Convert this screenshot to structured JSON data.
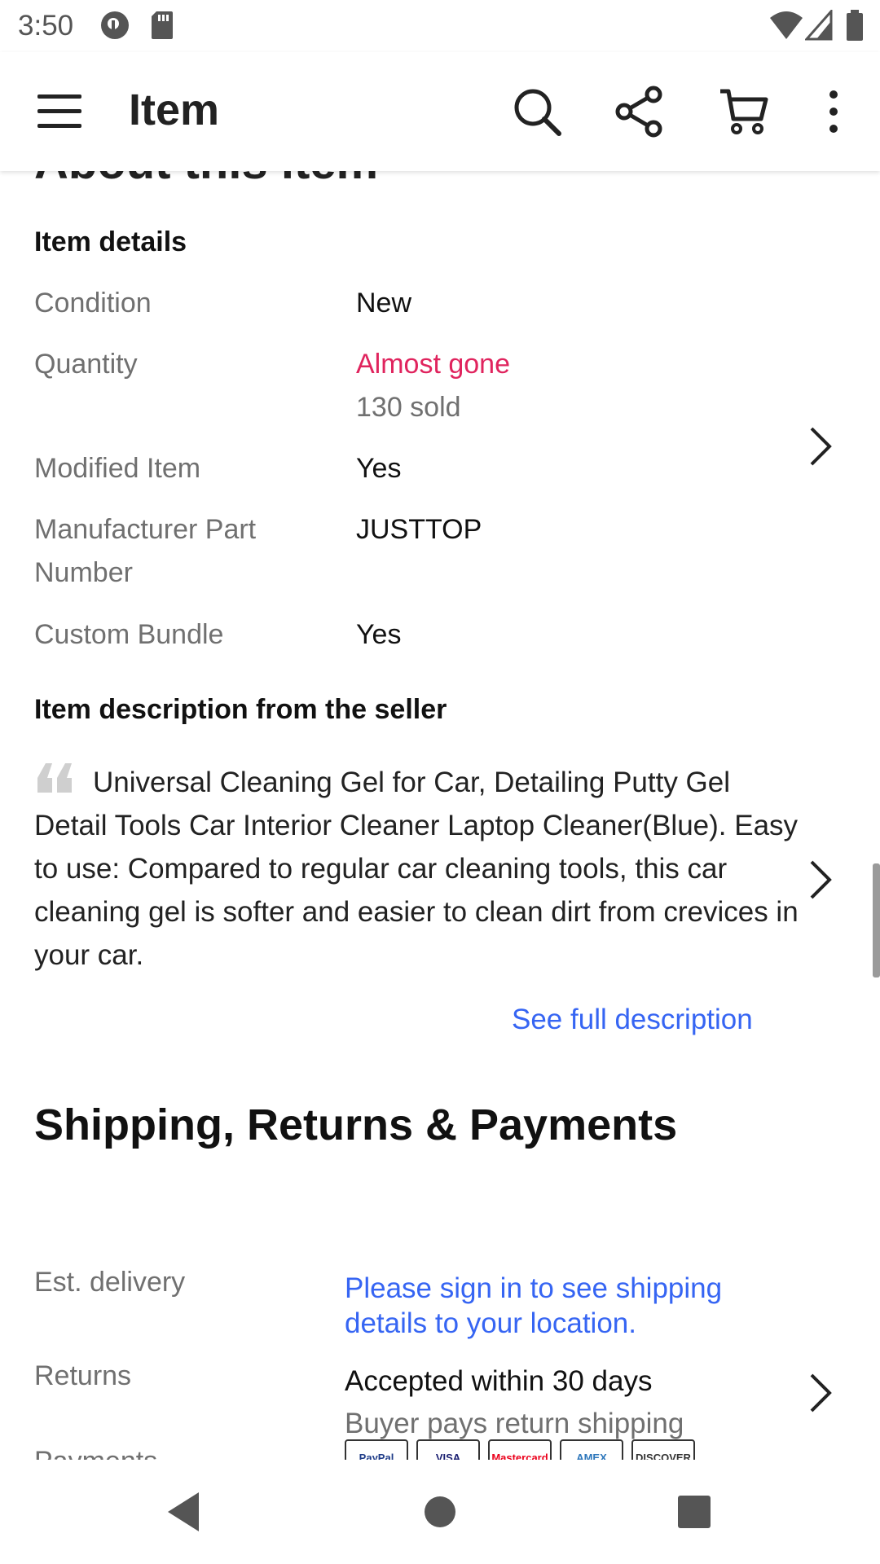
{
  "status_bar": {
    "time": "3:50",
    "icons": [
      "privacy-icon",
      "sd-card-icon",
      "wifi-icon",
      "cell-signal-icon",
      "battery-icon"
    ]
  },
  "app_bar": {
    "title": "Item",
    "icons": [
      "menu-icon",
      "search-icon",
      "share-icon",
      "cart-icon",
      "more-vert-icon"
    ]
  },
  "about": {
    "title_partial": "About this item"
  },
  "item_details": {
    "heading": "Item details",
    "rows": [
      {
        "label": "Condition",
        "value": "New"
      },
      {
        "label": "Quantity",
        "value": "Almost gone",
        "sub": "130 sold"
      },
      {
        "label": "Modified Item",
        "value": "Yes"
      },
      {
        "label": "Manufacturer Part Number",
        "value": "JUSTTOP"
      },
      {
        "label": "Custom Bundle",
        "value": "Yes"
      }
    ]
  },
  "description": {
    "heading": "Item description from the seller",
    "text": "Universal Cleaning Gel for Car, Detailing Putty Gel Detail Tools Car Interior Cleaner Laptop Cleaner(Blue). Easy to use: Compared to regular car cleaning tools, this car cleaning gel is softer and easier to clean dirt from crevices in your car.",
    "see_full_label": "See full description"
  },
  "shipping": {
    "heading": "Shipping, Returns & Payments",
    "est_delivery_label": "Est. delivery",
    "est_delivery_value": "Please sign in to see shipping details to your location.",
    "returns_label": "Returns",
    "returns_value": "Accepted within 30 days",
    "returns_sub": "Buyer pays return shipping",
    "payments_label": "Payments",
    "payment_methods": [
      "PayPal",
      "VISA",
      "Mastercard",
      "AMEX",
      "DISCOVER"
    ]
  },
  "colors": {
    "accent_link": "#3665f3",
    "alert_red": "#e0245e",
    "label_grey": "#707070"
  },
  "nav_bar": {
    "icons": [
      "back-icon",
      "home-icon",
      "recents-icon"
    ]
  }
}
